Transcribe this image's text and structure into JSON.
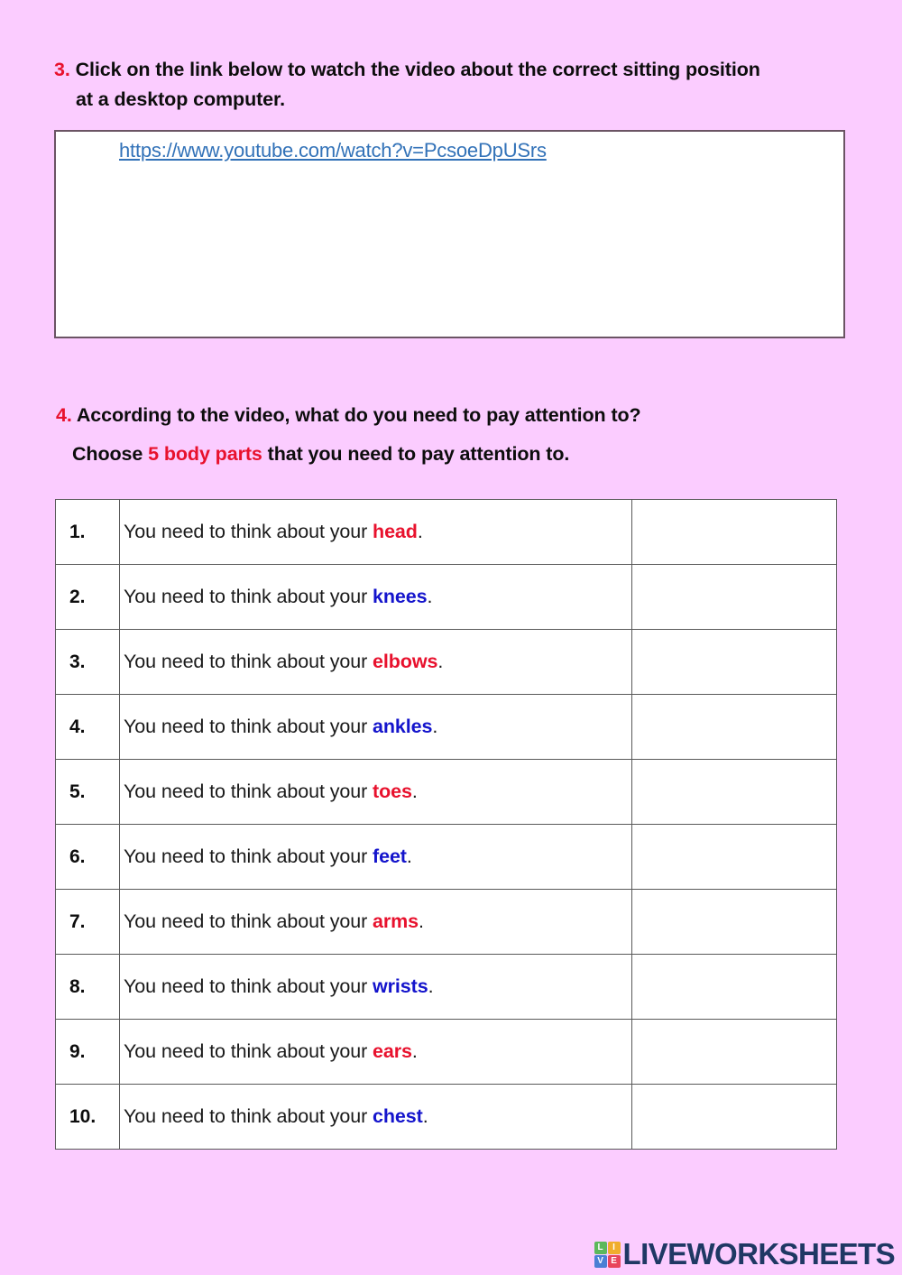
{
  "page": {
    "background_color": "#fbccff",
    "accent_red": "#e8112d",
    "accent_blue": "#1414cc",
    "link_color": "#3272b8"
  },
  "question3": {
    "number": "3.",
    "line1": "Click on the link below to watch the video about the correct sitting position",
    "line2": "at a desktop computer."
  },
  "video_box": {
    "link_text": "https://www.youtube.com/watch?v=PcsoeDpUSrs"
  },
  "question4": {
    "number": "4.",
    "line1": "According to the video, what do you need to pay attention to?",
    "line2_before": "Choose ",
    "line2_highlight": "5 body parts",
    "line2_after": " that you need to pay attention to."
  },
  "answer_table": {
    "sentence_prefix": "You need to think about your ",
    "sentence_suffix": ".",
    "rows": [
      {
        "number": "1.",
        "body_part": "head",
        "color": "red",
        "answer": ""
      },
      {
        "number": "2.",
        "body_part": "knees",
        "color": "blue",
        "answer": ""
      },
      {
        "number": "3.",
        "body_part": "elbows",
        "color": "red",
        "answer": ""
      },
      {
        "number": "4.",
        "body_part": "ankles",
        "color": "blue",
        "answer": ""
      },
      {
        "number": "5.",
        "body_part": "toes",
        "color": "red",
        "answer": ""
      },
      {
        "number": "6.",
        "body_part": "feet",
        "color": "blue",
        "answer": ""
      },
      {
        "number": "7.",
        "body_part": "arms",
        "color": "red",
        "answer": ""
      },
      {
        "number": "8.",
        "body_part": "wrists",
        "color": "blue",
        "answer": ""
      },
      {
        "number": "9.",
        "body_part": "ears",
        "color": "red",
        "answer": ""
      },
      {
        "number": "10.",
        "body_part": "chest",
        "color": "blue",
        "answer": ""
      }
    ]
  },
  "footer": {
    "logo_tiles": [
      "L",
      "I",
      "V",
      "E"
    ],
    "logo_text": "LIVEWORKSHEETS"
  }
}
